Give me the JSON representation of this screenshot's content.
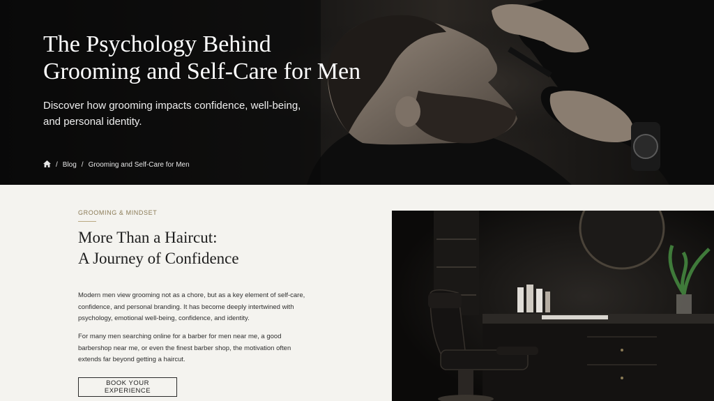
{
  "hero": {
    "title_line1": "The Psychology Behind",
    "title_line2": "Grooming and Self-Care for Men",
    "subtitle_line1": "Discover how grooming impacts confidence, well-being,",
    "subtitle_line2": "and personal identity.",
    "photo_alt": "Barber trimming a man's beard"
  },
  "breadcrumb": {
    "home_icon": "home-icon",
    "separator": "/",
    "items": [
      "Blog",
      "Grooming and Self-Care for Men"
    ]
  },
  "article": {
    "eyebrow": "GROOMING & MINDSET",
    "title_line1": "More Than a Haircut:",
    "title_line2": "A Journey of Confidence",
    "p1_lines": [
      "Modern men view grooming not as a chore, but as a key element of self-care,",
      "confidence, and personal branding. It has become deeply intertwined with",
      "psychology, emotional well-being, confidence, and identity."
    ],
    "p2_lines": [
      "For many men searching online for a barber for men near me, a good",
      "barbershop near me, or even the finest barber shop, the motivation often",
      "extends far beyond getting a haircut."
    ],
    "cta_label": "BOOK YOUR EXPERIENCE",
    "image_alt": "Dark barbershop interior with leather chair and mirror"
  },
  "colors": {
    "page_bg": "#f4f3ef",
    "accent": "#8a7a55",
    "text_dark": "#1d1d1d"
  }
}
